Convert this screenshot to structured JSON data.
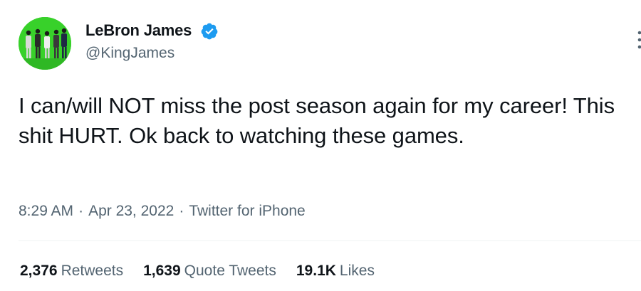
{
  "author": {
    "name": "LeBron James",
    "handle": "@KingJames",
    "verified": true
  },
  "tweet": {
    "text": "I can/will NOT miss the post season again for my career! This shit HURT. Ok back to watching these games.",
    "time": "8:29 AM",
    "separator": "·",
    "date": "Apr 23, 2022",
    "source": "Twitter for iPhone"
  },
  "stats": {
    "retweets_count": "2,376",
    "retweets_label": "Retweets",
    "quote_tweets_count": "1,639",
    "quote_tweets_label": "Quote Tweets",
    "likes_count": "19.1K",
    "likes_label": "Likes"
  },
  "colors": {
    "verified": "#1d9bf0",
    "avatar_bg": "#38d12a",
    "secondary_text": "#536471"
  },
  "icons": {
    "verified": "verified-badge-icon",
    "more": "more-options-icon"
  }
}
